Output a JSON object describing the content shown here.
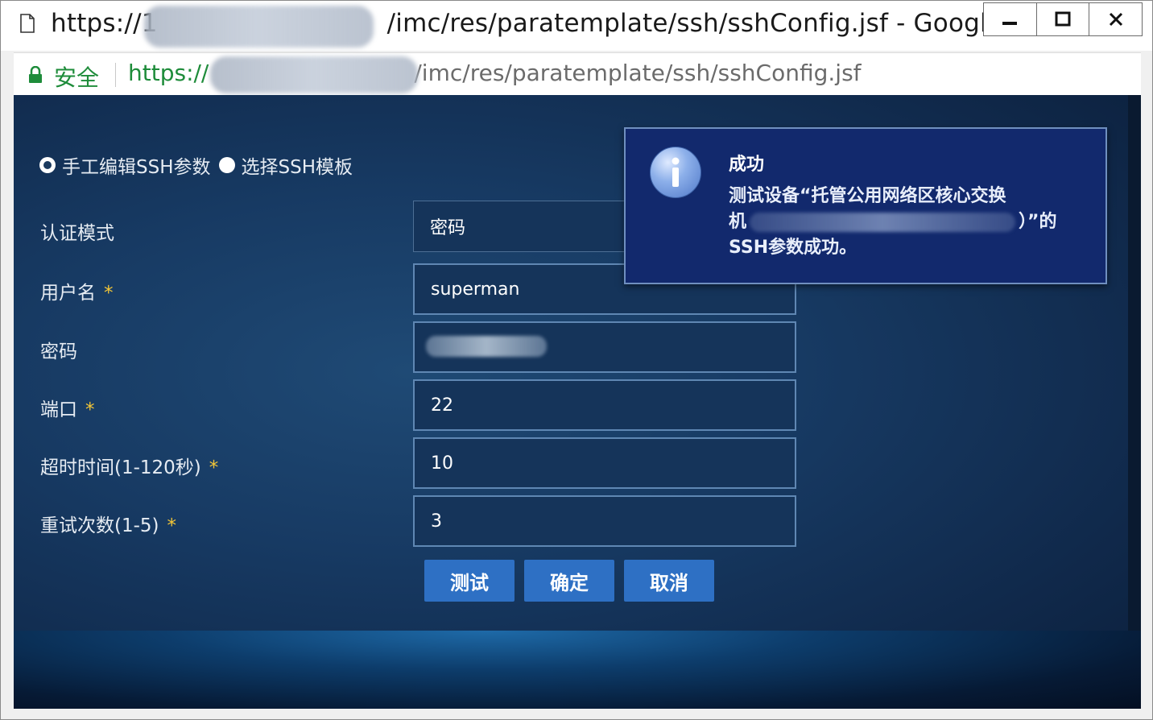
{
  "window": {
    "title_prefix": "https://1",
    "title_suffix": "/imc/res/paratemplate/ssh/sshConfig.jsf - Google ...",
    "controls": {
      "minimize": "–",
      "maximize": "□",
      "close": "X"
    }
  },
  "address_bar": {
    "security_label": "安全",
    "url_scheme": "https://",
    "url_path": "/imc/res/paratemplate/ssh/sshConfig.jsf"
  },
  "mode": {
    "options": [
      {
        "label": "手工编辑SSH参数",
        "checked": true
      },
      {
        "label": "选择SSH模板",
        "checked": false
      }
    ]
  },
  "form": {
    "auth_mode": {
      "label": "认证模式",
      "value": "密码"
    },
    "username": {
      "label": "用户名",
      "required_mark": "*",
      "value": "superman"
    },
    "password": {
      "label": "密码",
      "value": ""
    },
    "port": {
      "label": "端口",
      "required_mark": "*",
      "value": "22"
    },
    "timeout": {
      "label": "超时时间(1-120秒)",
      "required_mark": "*",
      "value": "10"
    },
    "retries": {
      "label": "重试次数(1-5)",
      "required_mark": "*",
      "value": "3"
    }
  },
  "buttons": {
    "test": "测试",
    "ok": "确定",
    "cancel": "取消"
  },
  "toast": {
    "title": "成功",
    "message_line1": "测试设备“托管公用网络区核心交换",
    "message_line2_prefix": "机",
    "message_line2_suffix": "）”的",
    "message_line3": "SSH参数成功。"
  },
  "colors": {
    "secure_green": "#1e8c3a",
    "panel_bg": "#173a63",
    "button_blue": "#2e70c4",
    "required_yellow": "#f3c637",
    "toast_bg": "#12296d"
  },
  "icons": [
    "page-icon",
    "lock-icon",
    "minimize-icon",
    "maximize-icon",
    "close-icon",
    "info-icon"
  ]
}
